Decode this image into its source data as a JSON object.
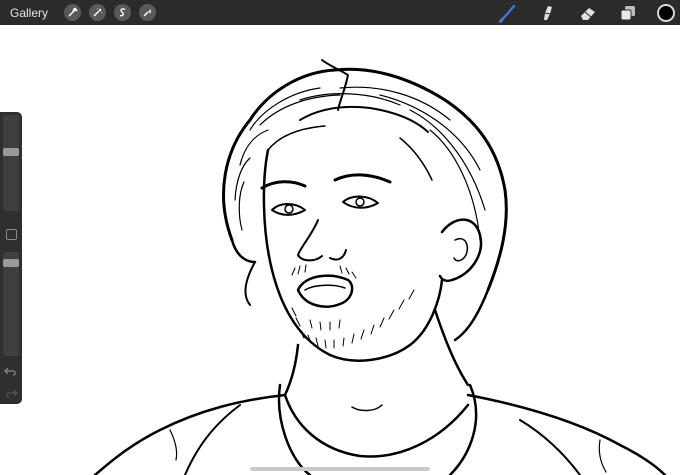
{
  "topbar": {
    "gallery_label": "Gallery",
    "left_tools": [
      "wrench-icon",
      "magic-wand-icon",
      "selection-icon",
      "transform-arrow-icon"
    ],
    "right_tools": [
      "brush-icon",
      "smudge-icon",
      "eraser-icon",
      "layers-icon"
    ],
    "active_tool": "brush-icon",
    "accent_color": "#3d7be0",
    "current_color": "#000000"
  },
  "sidebar": {
    "brush_size_level": 0.62,
    "opacity_level": 0.93
  }
}
